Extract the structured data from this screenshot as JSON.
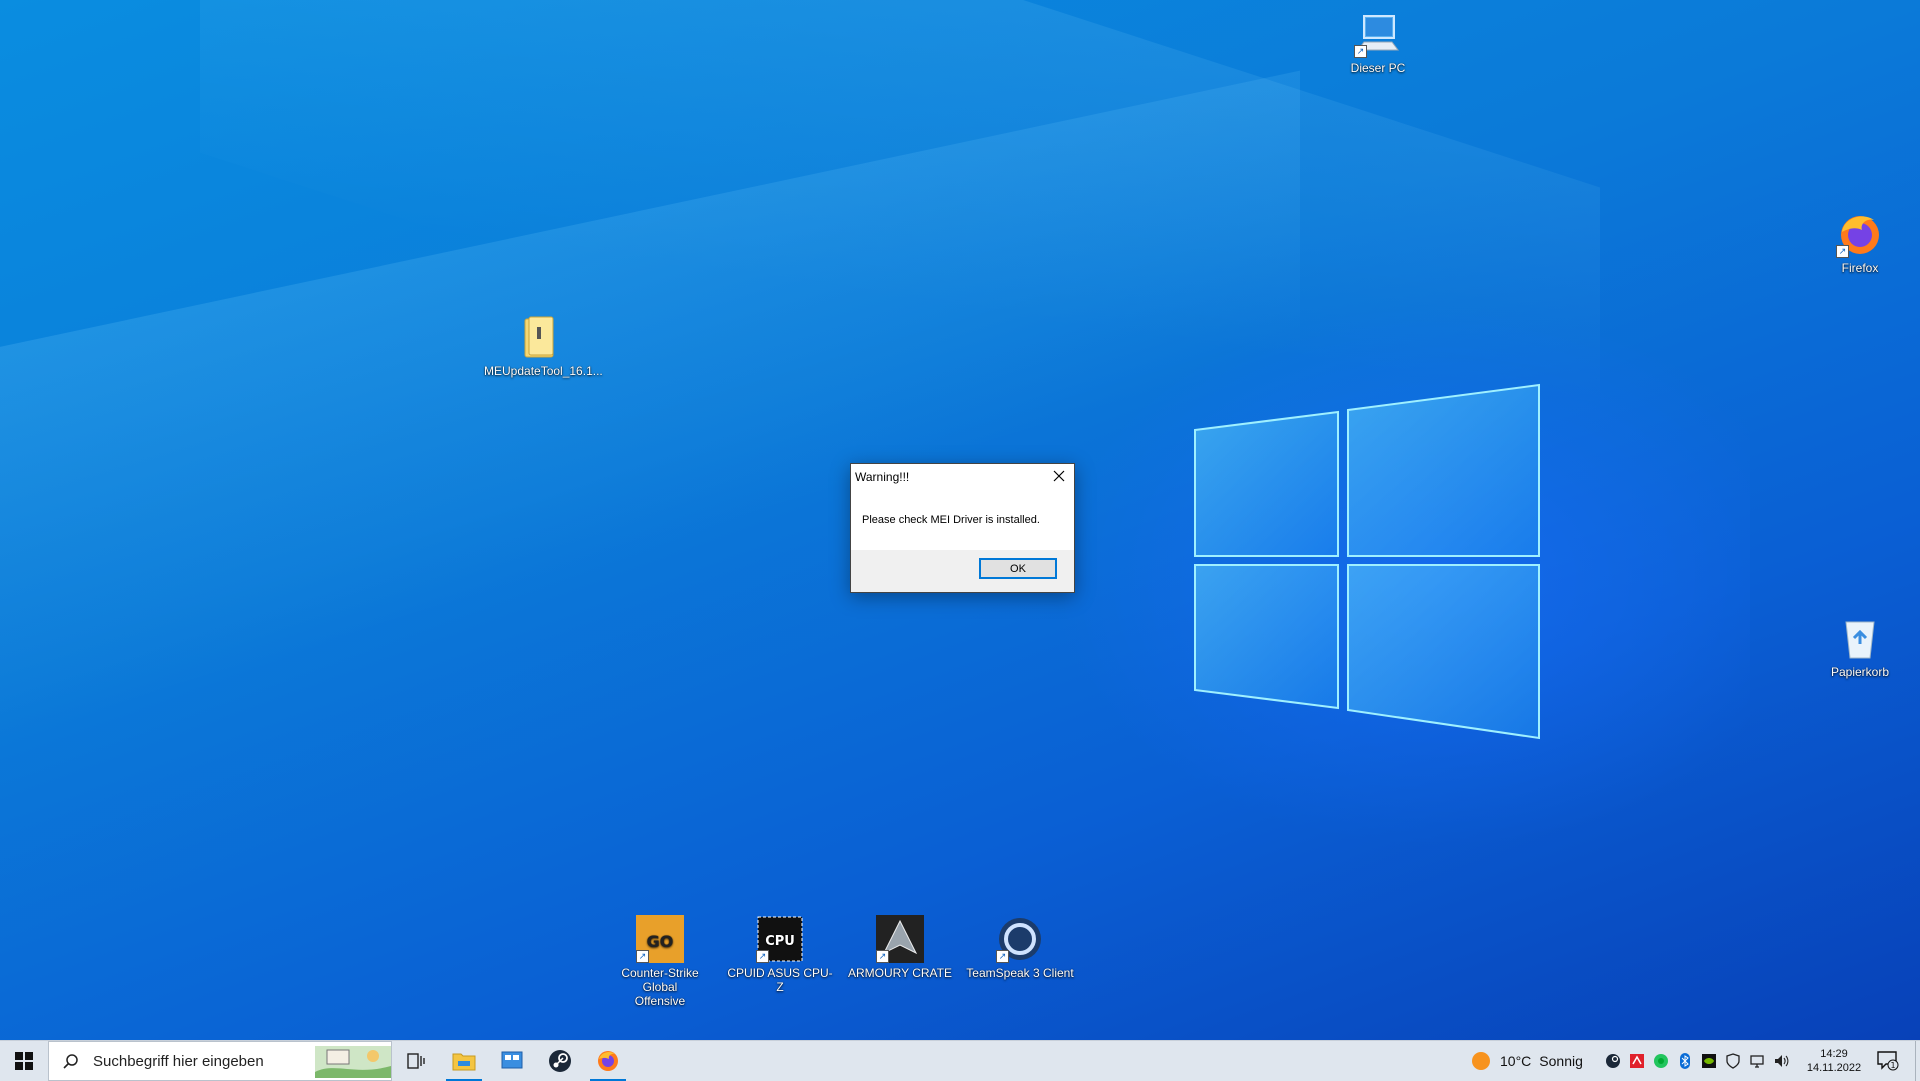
{
  "desktop": {
    "icons": {
      "this_pc": "Dieser PC",
      "firefox": "Firefox",
      "meupdate": "MEUpdateTool_16.1...",
      "recycle_bin": "Papierkorb",
      "csgo_line1": "Counter-Strike Global",
      "csgo_line2": "Offensive",
      "cpuz": "CPUID ASUS CPU-Z",
      "armoury": "ARMOURY CRATE",
      "teamspeak": "TeamSpeak 3 Client"
    },
    "icon_names": {
      "this_pc": "monitor-icon",
      "firefox": "firefox-icon",
      "meupdate": "folder-zip-icon",
      "recycle_bin": "recycle-bin-icon",
      "csgo": "csgo-icon",
      "cpuz": "cpuz-icon",
      "armoury": "armoury-crate-icon",
      "teamspeak": "teamspeak-icon"
    }
  },
  "dialog": {
    "title": "Warning!!!",
    "message": "Please check MEI Driver is installed.",
    "ok_label": "OK"
  },
  "taskbar": {
    "search_placeholder": "Suchbegriff hier eingeben",
    "weather_temp": "10°C",
    "weather_desc": "Sonnig",
    "time": "14:29",
    "date": "14.11.2022",
    "notification_count": "1",
    "pinned": [
      "task-view",
      "file-explorer",
      "control-panel",
      "steam",
      "firefox"
    ]
  },
  "colors": {
    "accent": "#0078d7",
    "desktop_blue": "#0b7ad8",
    "taskbar_bg": "#dfe6ee"
  }
}
